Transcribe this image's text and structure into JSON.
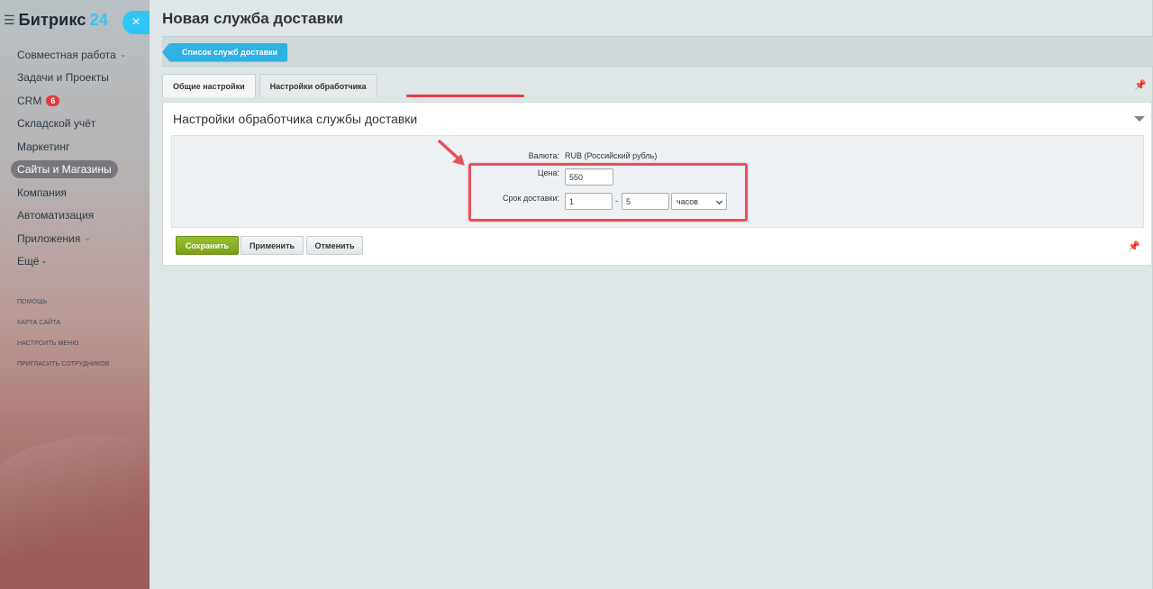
{
  "sidebar": {
    "logo_text": "Битрикс",
    "logo_num": "24",
    "close_icon": "×",
    "items": [
      {
        "label": "Совместная работа",
        "chevron": true
      },
      {
        "label": "Задачи и Проекты"
      },
      {
        "label": "CRM",
        "badge": "6"
      },
      {
        "label": "Складской учёт"
      },
      {
        "label": "Маркетинг"
      },
      {
        "label": "Сайты и Магазины",
        "active": true
      },
      {
        "label": "Компания"
      },
      {
        "label": "Автоматизация"
      },
      {
        "label": "Приложения",
        "chevron": true
      },
      {
        "label": "Ещё -"
      }
    ],
    "util_links": [
      "ПОМОЩЬ",
      "КАРТА САЙТА",
      "НАСТРОИТЬ МЕНЮ",
      "ПРИГЛАСИТЬ СОТРУДНИКОВ"
    ]
  },
  "page": {
    "title": "Новая служба доставки",
    "back_button": "Список служб доставки",
    "tabs": [
      {
        "label": "Общие настройки"
      },
      {
        "label": "Настройки обработчика",
        "active": true
      }
    ],
    "panel_title": "Настройки обработчика службы доставки",
    "form": {
      "currency_label": "Валюта:",
      "currency_value": "RUB (Российский рубль)",
      "price_label": "Цена:",
      "price_value": "550",
      "delivery_label": "Срок доставки:",
      "delivery_from": "1",
      "delivery_sep": "-",
      "delivery_to": "5",
      "delivery_unit": "часов"
    },
    "buttons": {
      "save": "Сохранить",
      "apply": "Применить",
      "cancel": "Отменить"
    }
  },
  "colors": {
    "accent": "#2fc6f6",
    "save_green": "#79a01a",
    "annotation_red": "#e8505b"
  }
}
